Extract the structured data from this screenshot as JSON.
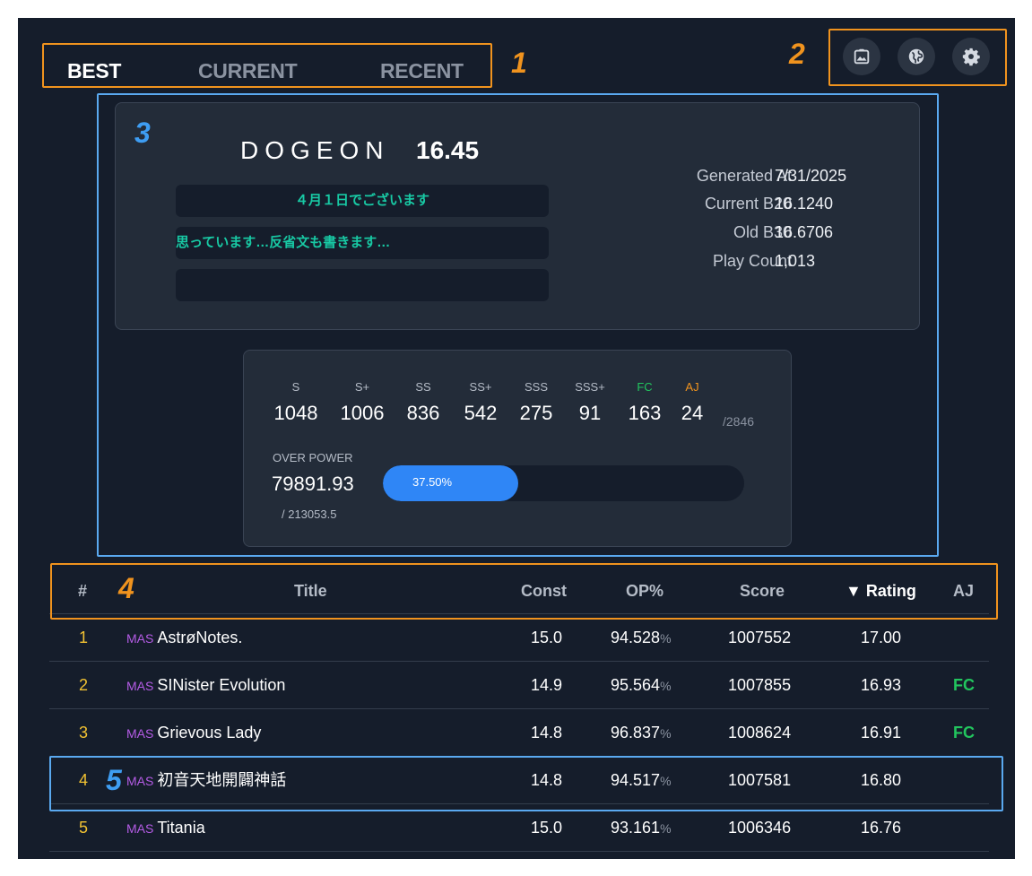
{
  "tabs": [
    "BEST",
    "CURRENT",
    "RECENT"
  ],
  "icons": [
    "image-icon",
    "globe-icon",
    "gear-icon"
  ],
  "annotations": [
    "1",
    "2",
    "3",
    "4",
    "5"
  ],
  "profile": {
    "name": "DOGEON",
    "rating": "16.45",
    "comments": [
      "４月１日でございます",
      "思っています…反省文も書きます…",
      ""
    ],
    "stats": [
      {
        "label": "Generated At",
        "value": "7/31/2025"
      },
      {
        "label": "Current B20",
        "value": "16.1240"
      },
      {
        "label": "Old B30",
        "value": "16.6706"
      },
      {
        "label": "Play Count",
        "value": "1,013"
      }
    ]
  },
  "ranks": [
    {
      "label": "S",
      "value": "1048",
      "color": "#b5bcc7"
    },
    {
      "label": "S+",
      "value": "1006",
      "color": "#b5bcc7"
    },
    {
      "label": "SS",
      "value": "836",
      "color": "#b5bcc7"
    },
    {
      "label": "SS+",
      "value": "542",
      "color": "#b5bcc7"
    },
    {
      "label": "SSS",
      "value": "275",
      "color": "#b5bcc7"
    },
    {
      "label": "SSS+",
      "value": "91",
      "color": "#b5bcc7"
    },
    {
      "label": "FC",
      "value": "163",
      "color": "#22c55e"
    },
    {
      "label": "AJ",
      "value": "24",
      "color": "#f0931e"
    }
  ],
  "rank_total": "/2846",
  "over_power": {
    "label": "OVER POWER",
    "value": "79891.93",
    "max": "/ 213053.5",
    "percent_label": "37.50%",
    "fraction": 0.375
  },
  "table": {
    "headers": [
      "#",
      "Title",
      "Const",
      "OP%",
      "Score",
      "▼ Rating",
      "AJ"
    ],
    "rows": [
      {
        "rank": "1",
        "diff": "MAS",
        "title": "AstrøNotes.",
        "const": "15.0",
        "op": "94.528",
        "unit": "%",
        "score": "1007552",
        "rating": "17.00",
        "aj": ""
      },
      {
        "rank": "2",
        "diff": "MAS",
        "title": "SINister Evolution",
        "const": "14.9",
        "op": "95.564",
        "unit": "%",
        "score": "1007855",
        "rating": "16.93",
        "aj": "FC"
      },
      {
        "rank": "3",
        "diff": "MAS",
        "title": "Grievous Lady",
        "const": "14.8",
        "op": "96.837",
        "unit": "%",
        "score": "1008624",
        "rating": "16.91",
        "aj": "FC"
      },
      {
        "rank": "4",
        "diff": "MAS",
        "title": "初音天地開闢神話",
        "const": "14.8",
        "op": "94.517",
        "unit": "%",
        "score": "1007581",
        "rating": "16.80",
        "aj": ""
      },
      {
        "rank": "5",
        "diff": "MAS",
        "title": "Titania",
        "const": "15.0",
        "op": "93.161",
        "unit": "%",
        "score": "1006346",
        "rating": "16.76",
        "aj": ""
      }
    ]
  },
  "colors": {
    "background": "#151d2b",
    "card": "#232c39",
    "accent": "#2f86f6",
    "annotation_orange": "#f0931e",
    "annotation_blue": "#3e9df2",
    "rank_number": "#f2c232",
    "difficulty": "#b55ce6",
    "fc_green": "#22c55e"
  }
}
